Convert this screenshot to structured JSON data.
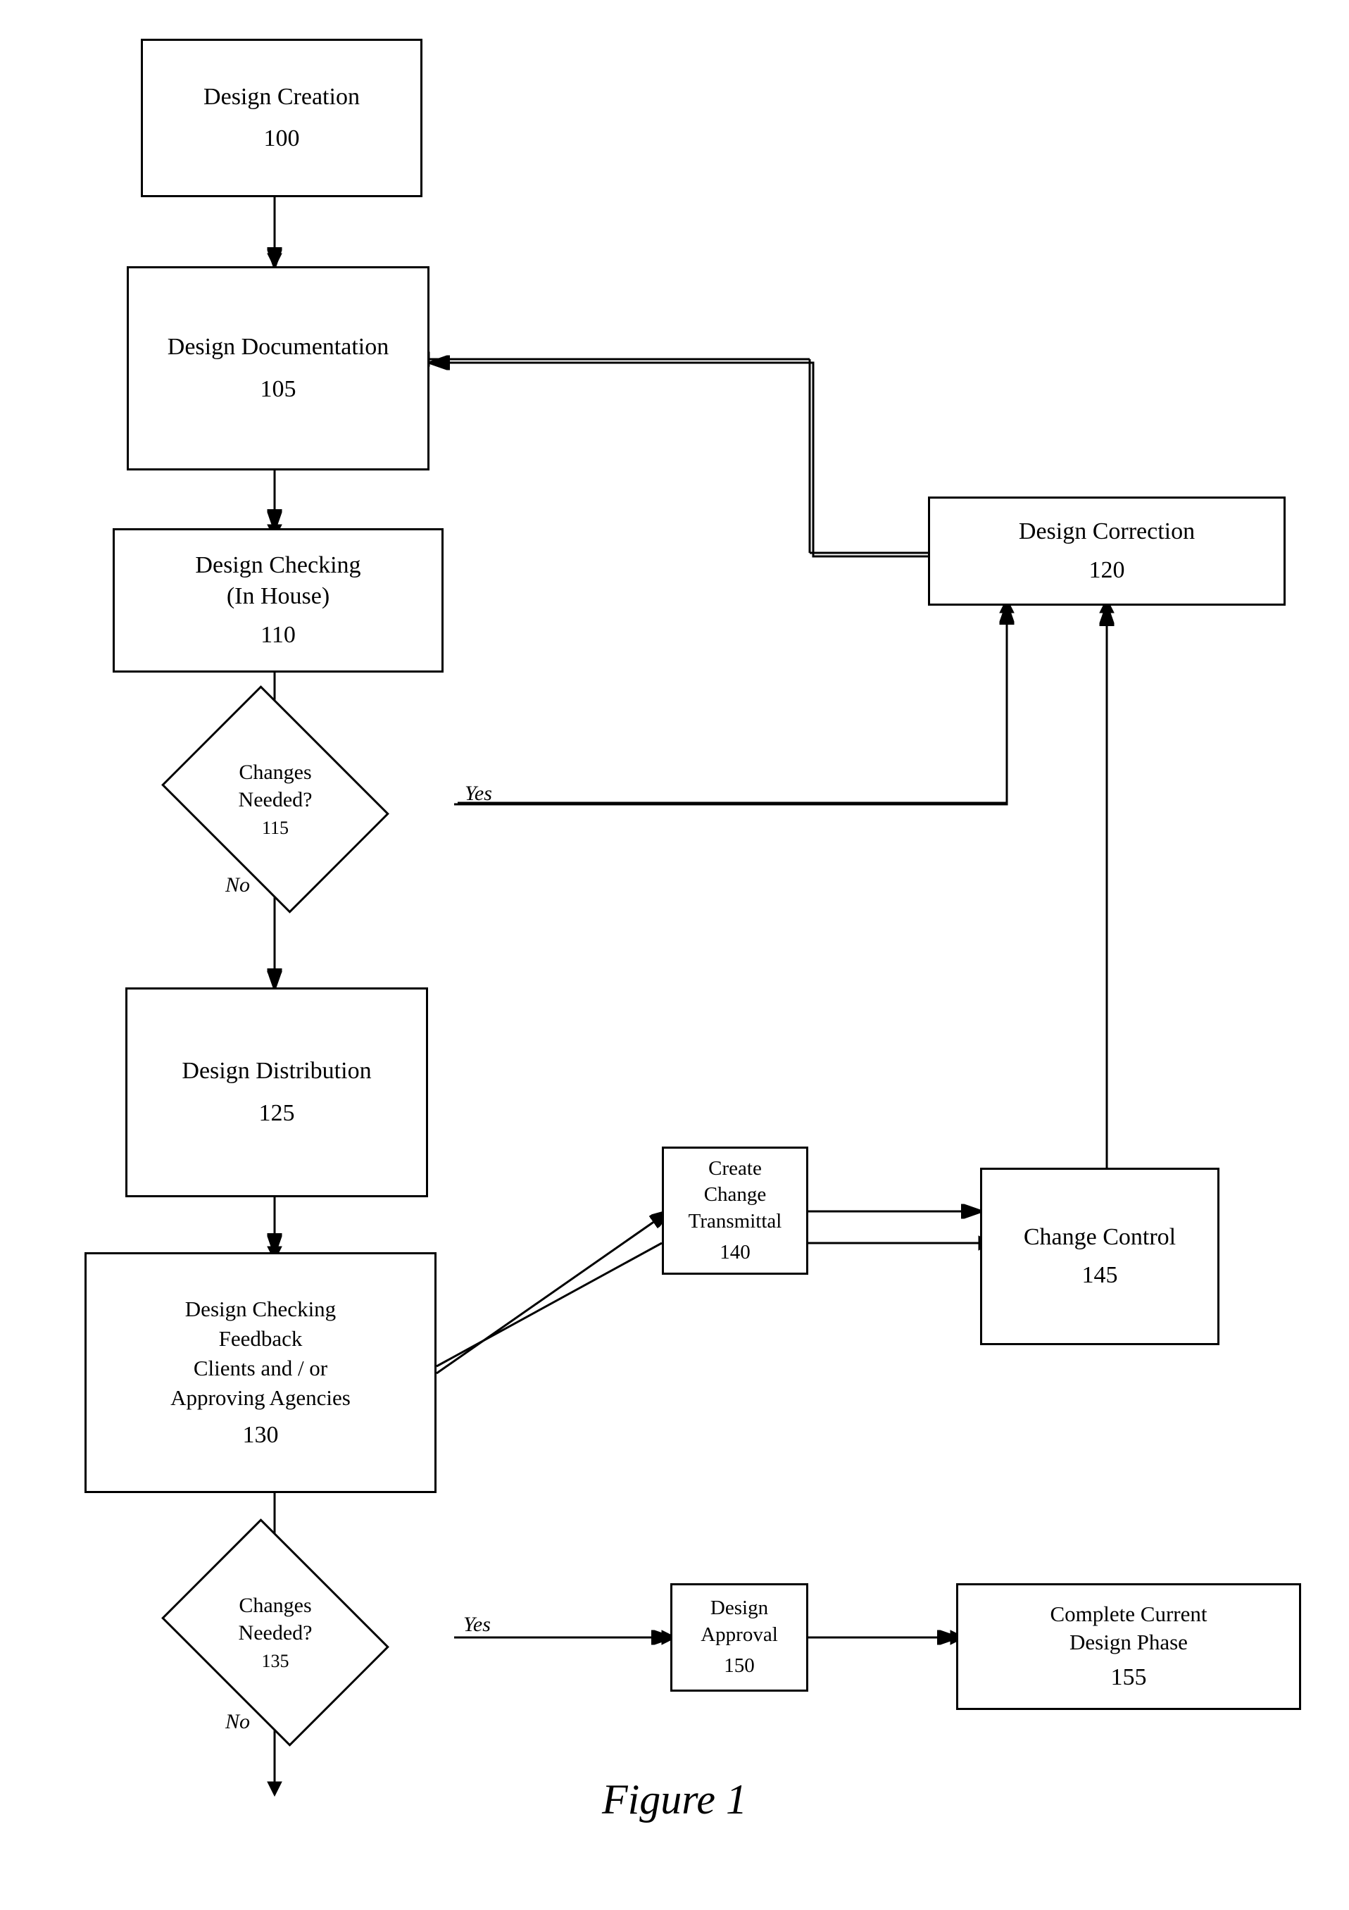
{
  "diagram": {
    "title": "Figure 1",
    "nodes": {
      "design_creation": {
        "label": "Design Creation",
        "number": "100"
      },
      "design_documentation": {
        "label": "Design Documentation",
        "number": "105"
      },
      "design_checking_inhouse": {
        "label": "Design Checking\n(In House)",
        "number": "110"
      },
      "changes_needed_115": {
        "label": "Changes Needed?",
        "number": "115"
      },
      "design_distribution": {
        "label": "Design Distribution",
        "number": "125"
      },
      "design_checking_feedback": {
        "label": "Design Checking Feedback Clients and / or Approving Agencies",
        "number": "130"
      },
      "changes_needed_135": {
        "label": "Changes Needed?",
        "number": "135"
      },
      "design_correction": {
        "label": "Design Correction",
        "number": "120"
      },
      "create_change_transmittal": {
        "label": "Create Change Transmittal",
        "number": "140"
      },
      "change_control": {
        "label": "Change Control",
        "number": "145"
      },
      "design_approval": {
        "label": "Design Approval",
        "number": "150"
      },
      "complete_current": {
        "label": "Complete Current Design Phase",
        "number": "155"
      }
    },
    "labels": {
      "yes": "Yes",
      "no": "No"
    }
  }
}
